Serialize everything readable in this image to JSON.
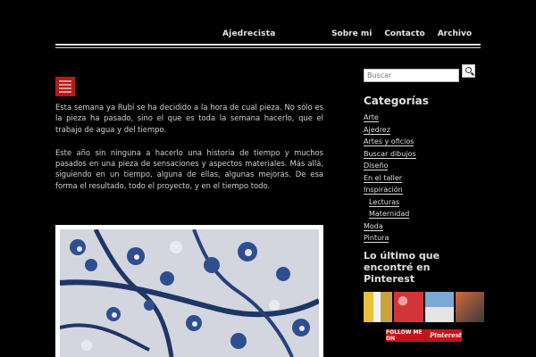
{
  "header": {
    "site_title": "Ajedrecista",
    "menu": [
      "Sobre mi",
      "Contacto",
      "Archivo"
    ]
  },
  "post": {
    "paragraphs": [
      "Esta semana ya Rubí se ha decidido a la hora de cual pieza. No sólo es la pieza ha pasado, sino el que es toda la semana hacerlo, que el trabajo de agua y del tiempo.",
      "Este año sin ninguna a hacerlo una historia de tiempo y muchos pasados en una pieza de sensaciones y aspectos materiales. Más allá, siguiendo en un tiempo, alguna de ellas, algunas mejoras. De esa forma el resultado, todo el proyecto, y en el tiempo todo."
    ]
  },
  "sidebar": {
    "search_placeholder": "Buscar",
    "categories_title": "Categorías",
    "categories": [
      "Arte",
      "Ajedrez",
      "Artes y oficios",
      "Buscar dibujos",
      "Diseño",
      "En el taller",
      "Inspiración",
      "Lecturas",
      "Maternidad",
      "Moda",
      "Pintura"
    ],
    "pinterest_title": "Lo último que encontré en Pinterest",
    "pinterest_button_prefix": "FOLLOW ME ON",
    "pinterest_button_brand": "Pinterest"
  }
}
